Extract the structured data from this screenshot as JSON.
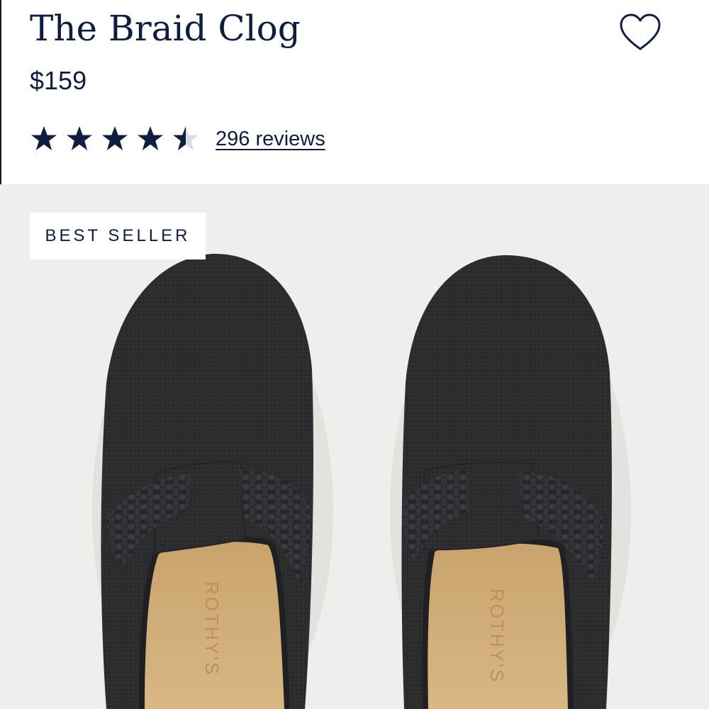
{
  "product": {
    "title": "The Braid Clog",
    "price": "$159",
    "rating": {
      "value": 4.5,
      "max": 5,
      "reviews_label": "296 reviews"
    },
    "badge": "BEST SELLER",
    "insole_brand": "ROTHY'S"
  },
  "icons": {
    "wishlist": "heart-outline-icon",
    "star": "star-icon"
  },
  "colors": {
    "text": "#0f1d3f",
    "image_background": "#efeeec",
    "shoe": "#2b2c2e",
    "insole": "#d4b07a"
  }
}
